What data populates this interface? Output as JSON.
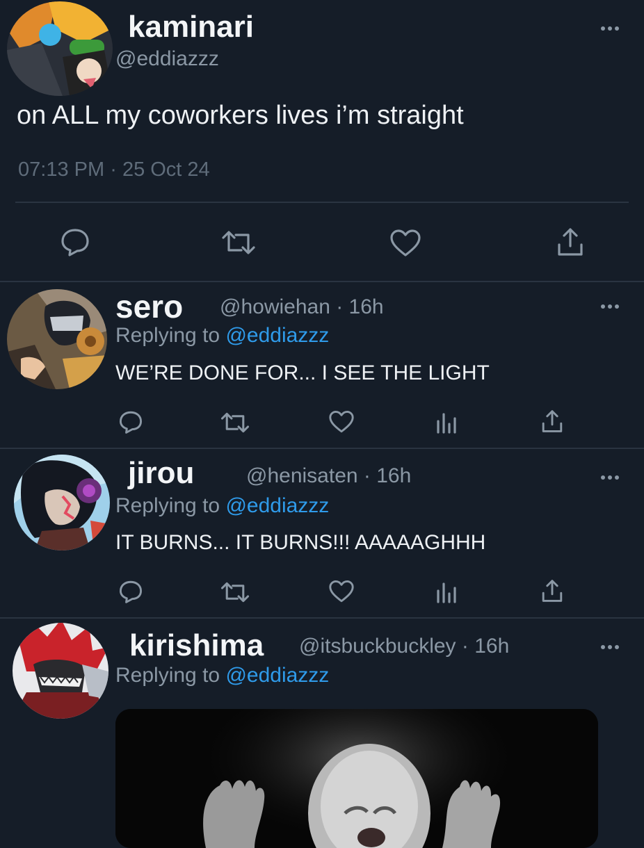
{
  "main_tweet": {
    "name": "kaminari",
    "handle": "@eddiazzz",
    "text": "on ALL my coworkers lives i’m straight",
    "time": "07:13 PM",
    "separator": "·",
    "date": "25 Oct 24",
    "actions": [
      "reply-icon",
      "retweet-icon",
      "like-icon",
      "share-icon"
    ]
  },
  "replies": [
    {
      "name": "sero",
      "handle": "@howiehan · 16h",
      "replying_prefix": "Replying to",
      "replying_to": "@eddiazzz",
      "text": "WE’RE DONE FOR... I SEE THE LIGHT",
      "actions": [
        "reply-icon",
        "retweet-icon",
        "like-icon",
        "analytics-icon",
        "share-icon"
      ]
    },
    {
      "name": "jirou",
      "handle": "@henisaten · 16h",
      "replying_prefix": "Replying to",
      "replying_to": "@eddiazzz",
      "text": "IT BURNS... IT BURNS!!! AAAAAGHHH",
      "actions": [
        "reply-icon",
        "retweet-icon",
        "like-icon",
        "analytics-icon",
        "share-icon"
      ]
    },
    {
      "name": "kirishima",
      "handle": "@itsbuckbuckley · 16h",
      "replying_prefix": "Replying to",
      "replying_to": "@eddiazzz",
      "media": "black-and-white photo of a screaming baby with raised hands"
    }
  ],
  "colors": {
    "background": "#151d28",
    "divider": "#2a3441",
    "muted": "#8b98a5",
    "link": "#2f9bea",
    "text": "#eef1f4"
  }
}
